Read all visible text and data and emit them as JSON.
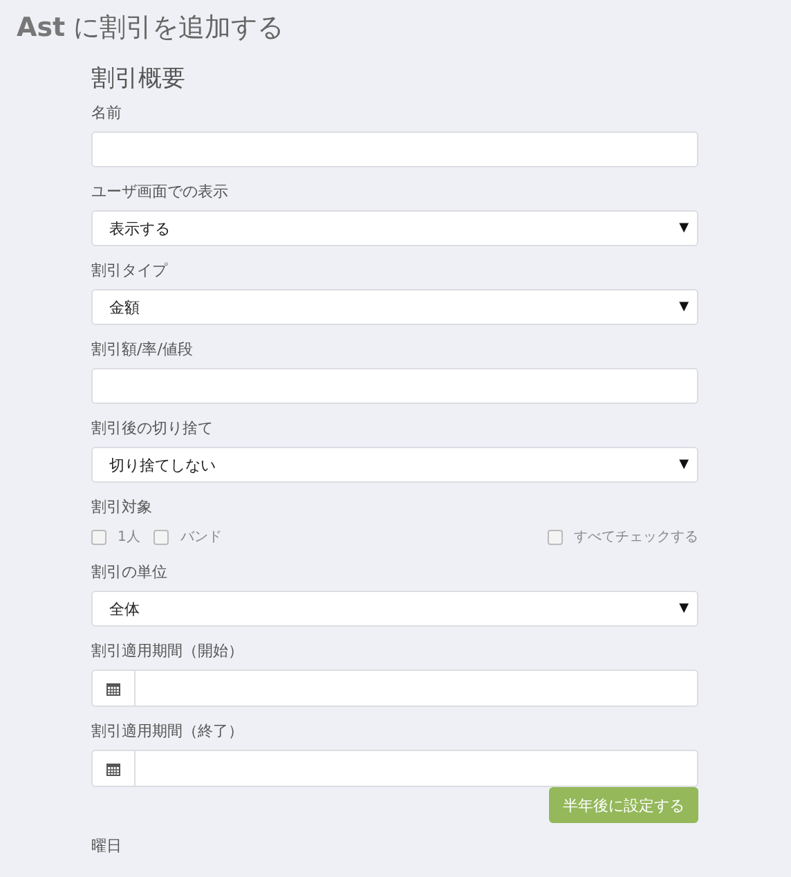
{
  "page_title": {
    "bold": "Ast",
    "rest": "に割引を追加する"
  },
  "section_title": "割引概要",
  "fields": [
    {
      "kind": "text",
      "label": "名前"
    },
    {
      "kind": "select",
      "label": "ユーザ画面での表示",
      "value": "表示する"
    },
    {
      "kind": "select",
      "label": "割引タイプ",
      "value": "金額"
    },
    {
      "kind": "text",
      "label": "割引額/率/値段"
    },
    {
      "kind": "select",
      "label": "割引後の切り捨て",
      "value": "切り捨てしない"
    },
    {
      "kind": "checks",
      "label": "割引対象",
      "options": [
        {
          "label": "1人",
          "checked": false
        },
        {
          "label": "バンド",
          "checked": false
        }
      ],
      "check_all": {
        "label": "すべてチェックする",
        "checked": false
      }
    },
    {
      "kind": "select",
      "label": "割引の単位",
      "value": "全体"
    },
    {
      "kind": "date",
      "label": "割引適用期間（開始）"
    },
    {
      "kind": "date",
      "label": "割引適用期間（終了）",
      "button": "半年後に設定する"
    },
    {
      "kind": "label",
      "label": "曜日"
    }
  ],
  "select_caret": "▼"
}
